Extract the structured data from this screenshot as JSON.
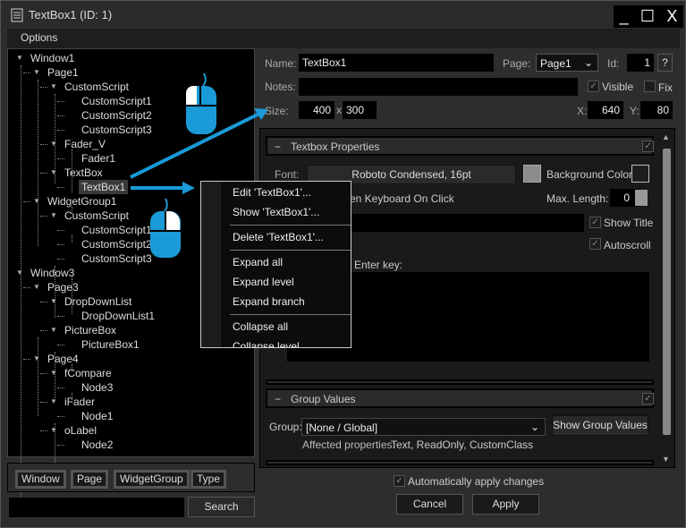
{
  "window": {
    "title": "TextBox1 (ID: 1)",
    "minimize": "_",
    "maximize": "☐",
    "close": "X"
  },
  "menu": {
    "options": "Options"
  },
  "tree": [
    {
      "label": "Window1",
      "level": 0,
      "expanded": true
    },
    {
      "label": "Page1",
      "level": 1,
      "expanded": true
    },
    {
      "label": "CustomScript",
      "level": 2,
      "expanded": true
    },
    {
      "label": "CustomScript1",
      "level": 3
    },
    {
      "label": "CustomScript2",
      "level": 3
    },
    {
      "label": "CustomScript3",
      "level": 3
    },
    {
      "label": "Fader_V",
      "level": 2,
      "expanded": true
    },
    {
      "label": "Fader1",
      "level": 3
    },
    {
      "label": "TextBox",
      "level": 2,
      "expanded": true
    },
    {
      "label": "TextBox1",
      "level": 3,
      "selected": true
    },
    {
      "label": "WidgetGroup1",
      "level": 1,
      "expanded": true
    },
    {
      "label": "CustomScript",
      "level": 2,
      "expanded": true
    },
    {
      "label": "CustomScript1",
      "level": 3
    },
    {
      "label": "CustomScript2",
      "level": 3
    },
    {
      "label": "CustomScript3",
      "level": 3
    },
    {
      "label": "Window3",
      "level": 0,
      "expanded": true
    },
    {
      "label": "Page3",
      "level": 1,
      "expanded": true
    },
    {
      "label": "DropDownList",
      "level": 2,
      "expanded": true
    },
    {
      "label": "DropDownList1",
      "level": 3
    },
    {
      "label": "PictureBox",
      "level": 2,
      "expanded": true
    },
    {
      "label": "PictureBox1",
      "level": 3
    },
    {
      "label": "Page4",
      "level": 1,
      "expanded": true
    },
    {
      "label": "fCompare",
      "level": 2,
      "expanded": true
    },
    {
      "label": "Node3",
      "level": 3
    },
    {
      "label": "iFader",
      "level": 2,
      "expanded": true
    },
    {
      "label": "Node1",
      "level": 3
    },
    {
      "label": "oLabel",
      "level": 2,
      "expanded": true
    },
    {
      "label": "Node2",
      "level": 3
    }
  ],
  "filters": [
    "Window",
    "Page",
    "WidgetGroup",
    "Type"
  ],
  "search": {
    "value": "",
    "button": "Search"
  },
  "props": {
    "name_label": "Name:",
    "name": "TextBox1",
    "page_label": "Page:",
    "page": "Page1",
    "id_label": "Id:",
    "id": "1",
    "help": "?",
    "notes_label": "Notes:",
    "notes": "",
    "visible_label": "Visible",
    "visible": true,
    "fix_label": "Fix",
    "fix": false,
    "size_label": "Size:",
    "width": "400",
    "x_sep": "x",
    "height": "300",
    "x_label": "X:",
    "x": "640",
    "y_label": "Y:",
    "y": "80"
  },
  "textbox_section": {
    "title": "Textbox Properties",
    "collapse": "−",
    "font_label": "Font:",
    "font": "Roboto Condensed, 16pt",
    "font_color": "#8c8c8c",
    "bg_label": "Background Color:",
    "bg_color": "#1e1e1e",
    "keyboard_label": "en Keyboard On Click",
    "maxlen_label": "Max. Length:",
    "maxlen": "0",
    "show_title": "Show Title",
    "autoscroll": "Autoscroll",
    "enter_label": "Enter key:"
  },
  "group_section": {
    "title": "Group Values",
    "collapse": "−",
    "group_label": "Group:",
    "group": "[None / Global]",
    "show_button": "Show Group Values",
    "affected_label": "Affected properties:",
    "affected": "Text, ReadOnly, CustomClass"
  },
  "footer": {
    "auto_apply": "Automatically apply changes",
    "auto_apply_checked": true,
    "cancel": "Cancel",
    "apply": "Apply"
  },
  "context_menu": [
    "Edit 'TextBox1'...",
    "Show 'TextBox1'...",
    "Delete 'TextBox1'...",
    "Expand all",
    "Expand level",
    "Expand branch",
    "Collapse all",
    "Collapse level"
  ],
  "colors": {
    "accent": "#1a9ad6"
  }
}
